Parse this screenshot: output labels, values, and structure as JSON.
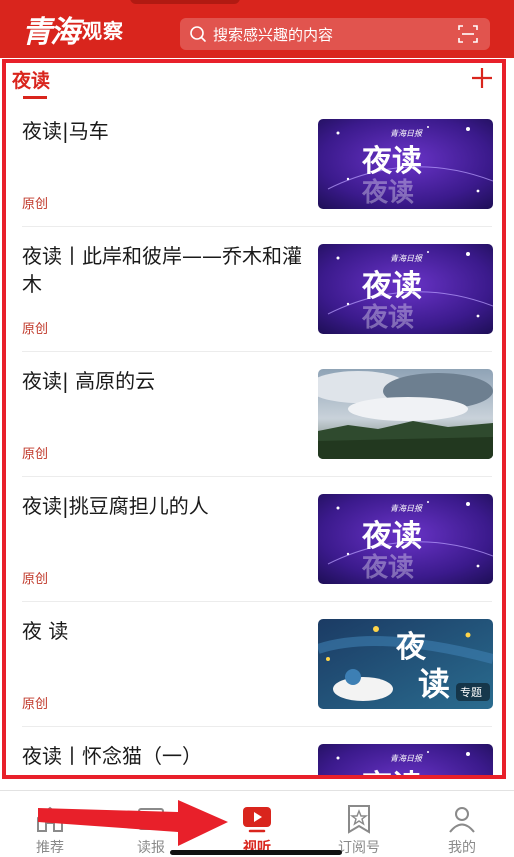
{
  "header": {
    "logo_main": "青海",
    "logo_sub": "观察",
    "search_placeholder": "搜索感兴趣的内容",
    "brand_color": "#d9251d"
  },
  "section": {
    "title": "夜读"
  },
  "feed": {
    "items": [
      {
        "title": "夜读|马车",
        "tag": "原创",
        "thumb": "yedu-purple"
      },
      {
        "title": "夜读丨此岸和彼岸——乔木和灌木",
        "tag": "原创",
        "thumb": "yedu-purple"
      },
      {
        "title": "夜读| 高原的云",
        "tag": "原创",
        "thumb": "sky-photo"
      },
      {
        "title": "夜读|挑豆腐担儿的人",
        "tag": "原创",
        "thumb": "yedu-purple"
      },
      {
        "title": "夜 读",
        "tag": "原创",
        "thumb": "yedu-night",
        "thumb_badge": "专题"
      },
      {
        "title": "夜读丨怀念猫（一）",
        "tag": "",
        "thumb": "yedu-purple"
      }
    ],
    "thumb_text": "夜读",
    "thumb_watermark": "青海日报"
  },
  "bottom_nav": {
    "items": [
      {
        "label": "推荐",
        "icon": "home-icon",
        "active": false
      },
      {
        "label": "读报",
        "icon": "newspaper-icon",
        "active": false
      },
      {
        "label": "视听",
        "icon": "video-play-icon",
        "active": true
      },
      {
        "label": "订阅号",
        "icon": "bookmark-star-icon",
        "active": false
      },
      {
        "label": "我的",
        "icon": "user-icon",
        "active": false
      }
    ]
  }
}
